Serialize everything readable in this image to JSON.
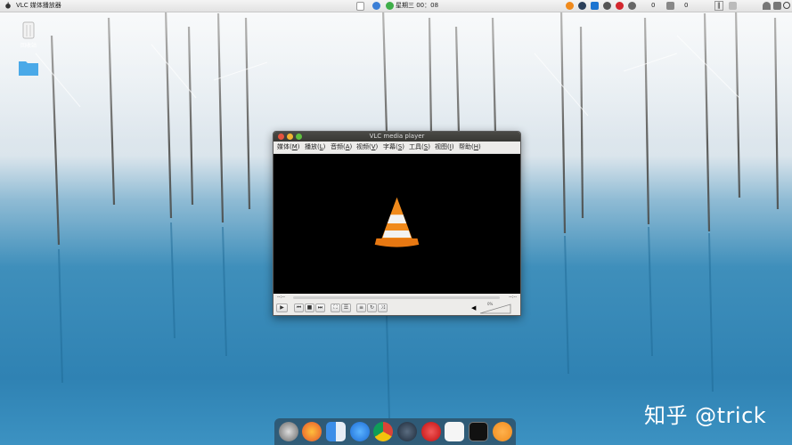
{
  "topbar": {
    "app_title": "VLC 媒体播放器",
    "clock": "星期三 00：08",
    "right_numbers": [
      "0",
      "0",
      "0"
    ],
    "pause_text": "‖",
    "icons": [
      "vlc-tray-icon",
      "steam-tray-icon",
      "teamviewer-tray-icon",
      "headphones-tray-icon",
      "netease-tray-icon",
      "chat-tray-icon",
      "network-tray-icon",
      "pause-icon",
      "volume-icon",
      "battery-icon"
    ]
  },
  "desktop": {
    "trash_label": "回收站",
    "folder_label": ""
  },
  "vlc": {
    "title": "VLC media player",
    "menu": [
      {
        "label": "媒体(",
        "key": "M",
        "end": ")"
      },
      {
        "label": "播放(",
        "key": "L",
        "end": ")"
      },
      {
        "label": "音频(",
        "key": "A",
        "end": ")"
      },
      {
        "label": "视频(",
        "key": "V",
        "end": ")"
      },
      {
        "label": "字幕(",
        "key": "S",
        "end": ")"
      },
      {
        "label": "工具(",
        "key": "S",
        "end": ")"
      },
      {
        "label": "视图(",
        "key": "I",
        "end": ")"
      },
      {
        "label": "帮助(",
        "key": "H",
        "end": ")"
      }
    ],
    "time_elapsed": "--:--",
    "time_remaining": "--:--",
    "volume_percent": "0%",
    "volume_level": 0
  },
  "dock": {
    "items": [
      "launchpad-icon",
      "firefox-icon",
      "finder-icon",
      "app-store-icon",
      "chrome-icon",
      "steam-icon",
      "netease-music-icon",
      "typora-icon",
      "terminal-icon",
      "vlc-icon"
    ]
  },
  "watermark": "知乎 @trick",
  "colors": {
    "vlc_orange": "#f08a1c",
    "close_red": "#e5543f",
    "min_yellow": "#f2b431",
    "max_green": "#5fbf3f"
  }
}
